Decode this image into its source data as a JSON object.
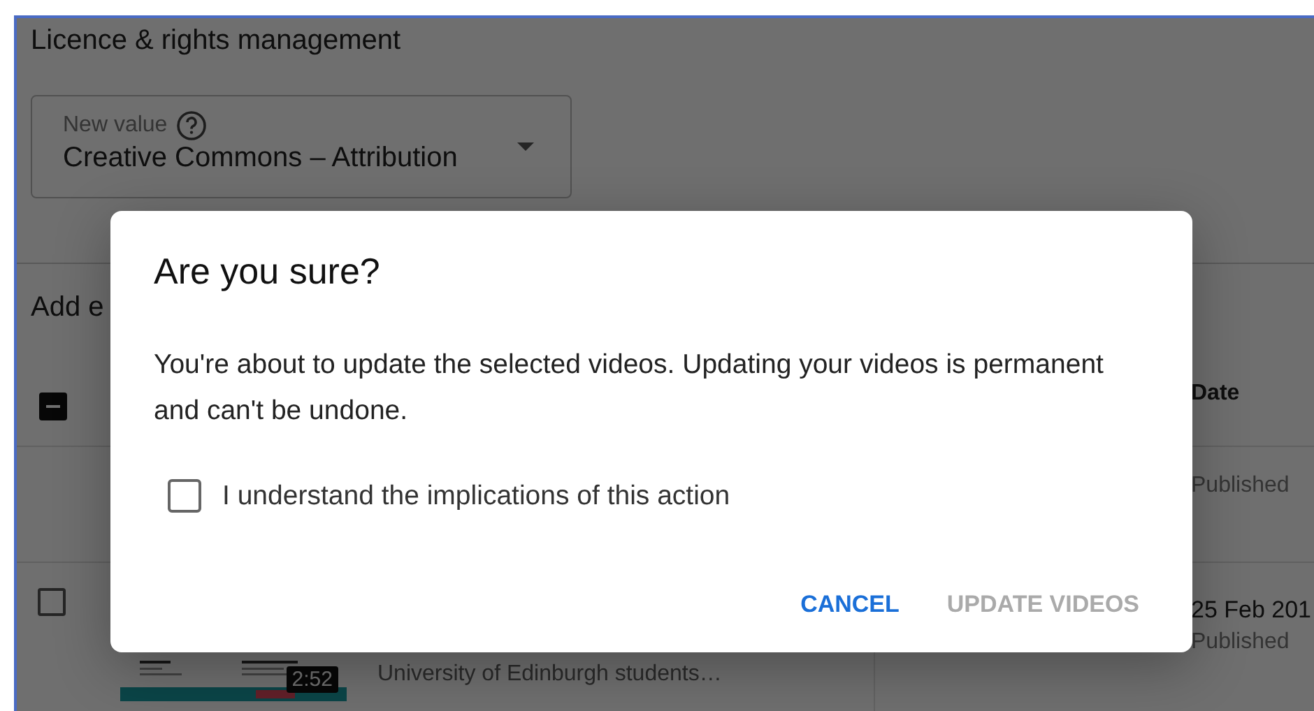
{
  "page": {
    "title": "Licence & rights management",
    "field": {
      "label": "New value",
      "value": "Creative Commons – Attribution"
    },
    "section_heading": "Add e"
  },
  "table": {
    "header": {
      "checked": true,
      "indeterminate": true,
      "date_column": "Date"
    },
    "rows": [
      {
        "date_status": "Published"
      },
      {
        "checked": false,
        "duration": "2:52",
        "title": "University of Edinburgh students…",
        "date": "25 Feb 201",
        "date_status": "Published"
      }
    ]
  },
  "dialog": {
    "title": "Are you sure?",
    "message": "You're about to update the selected videos. Updating your videos is permanent and can't be undone.",
    "checkbox": {
      "label": "I understand the implications of this action",
      "checked": false
    },
    "buttons": [
      {
        "label": "CANCEL",
        "disabled": false
      },
      {
        "label": "UPDATE VIDEOS",
        "disabled": true
      }
    ]
  }
}
